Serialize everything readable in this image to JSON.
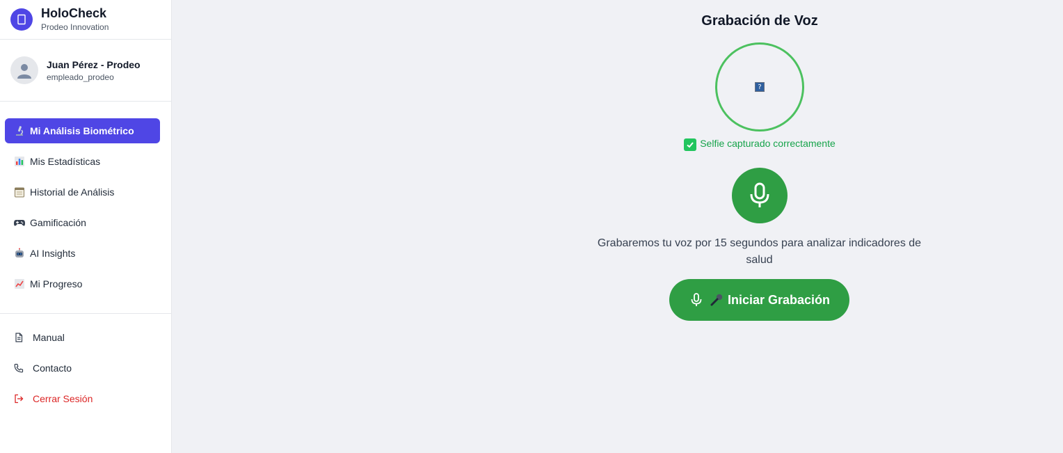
{
  "brand": {
    "name": "HoloCheck",
    "subtitle": "Prodeo Innovation"
  },
  "user": {
    "name": "Juan Pérez - Prodeo",
    "role": "empleado_prodeo"
  },
  "nav": {
    "items": [
      {
        "emoji": "microscope-emoji",
        "label": "Mi Análisis Biométrico",
        "active": true
      },
      {
        "emoji": "bar-chart-emoji",
        "label": "Mis Estadísticas",
        "active": false
      },
      {
        "emoji": "calendar-emoji",
        "label": "Historial de Análisis",
        "active": false
      },
      {
        "emoji": "game-controller-emoji",
        "label": "Gamificación",
        "active": false
      },
      {
        "emoji": "robot-emoji",
        "label": "AI Insights",
        "active": false
      },
      {
        "emoji": "chart-increasing-emoji",
        "label": "Mi Progreso",
        "active": false
      }
    ]
  },
  "bottom_nav": {
    "manual": "Manual",
    "contact": "Contacto",
    "logout": "Cerrar Sesión"
  },
  "main": {
    "title": "Grabación de Voz",
    "status": "Selfie capturado correctamente",
    "description": "Grabaremos tu voz por 15 segundos para analizar indicadores de salud",
    "record_button": "Iniciar Grabación"
  },
  "colors": {
    "accent": "#4f46e5",
    "success": "#2f9e44",
    "ring": "#4cc15f",
    "danger": "#dc2626",
    "background": "#f0f1f5"
  }
}
